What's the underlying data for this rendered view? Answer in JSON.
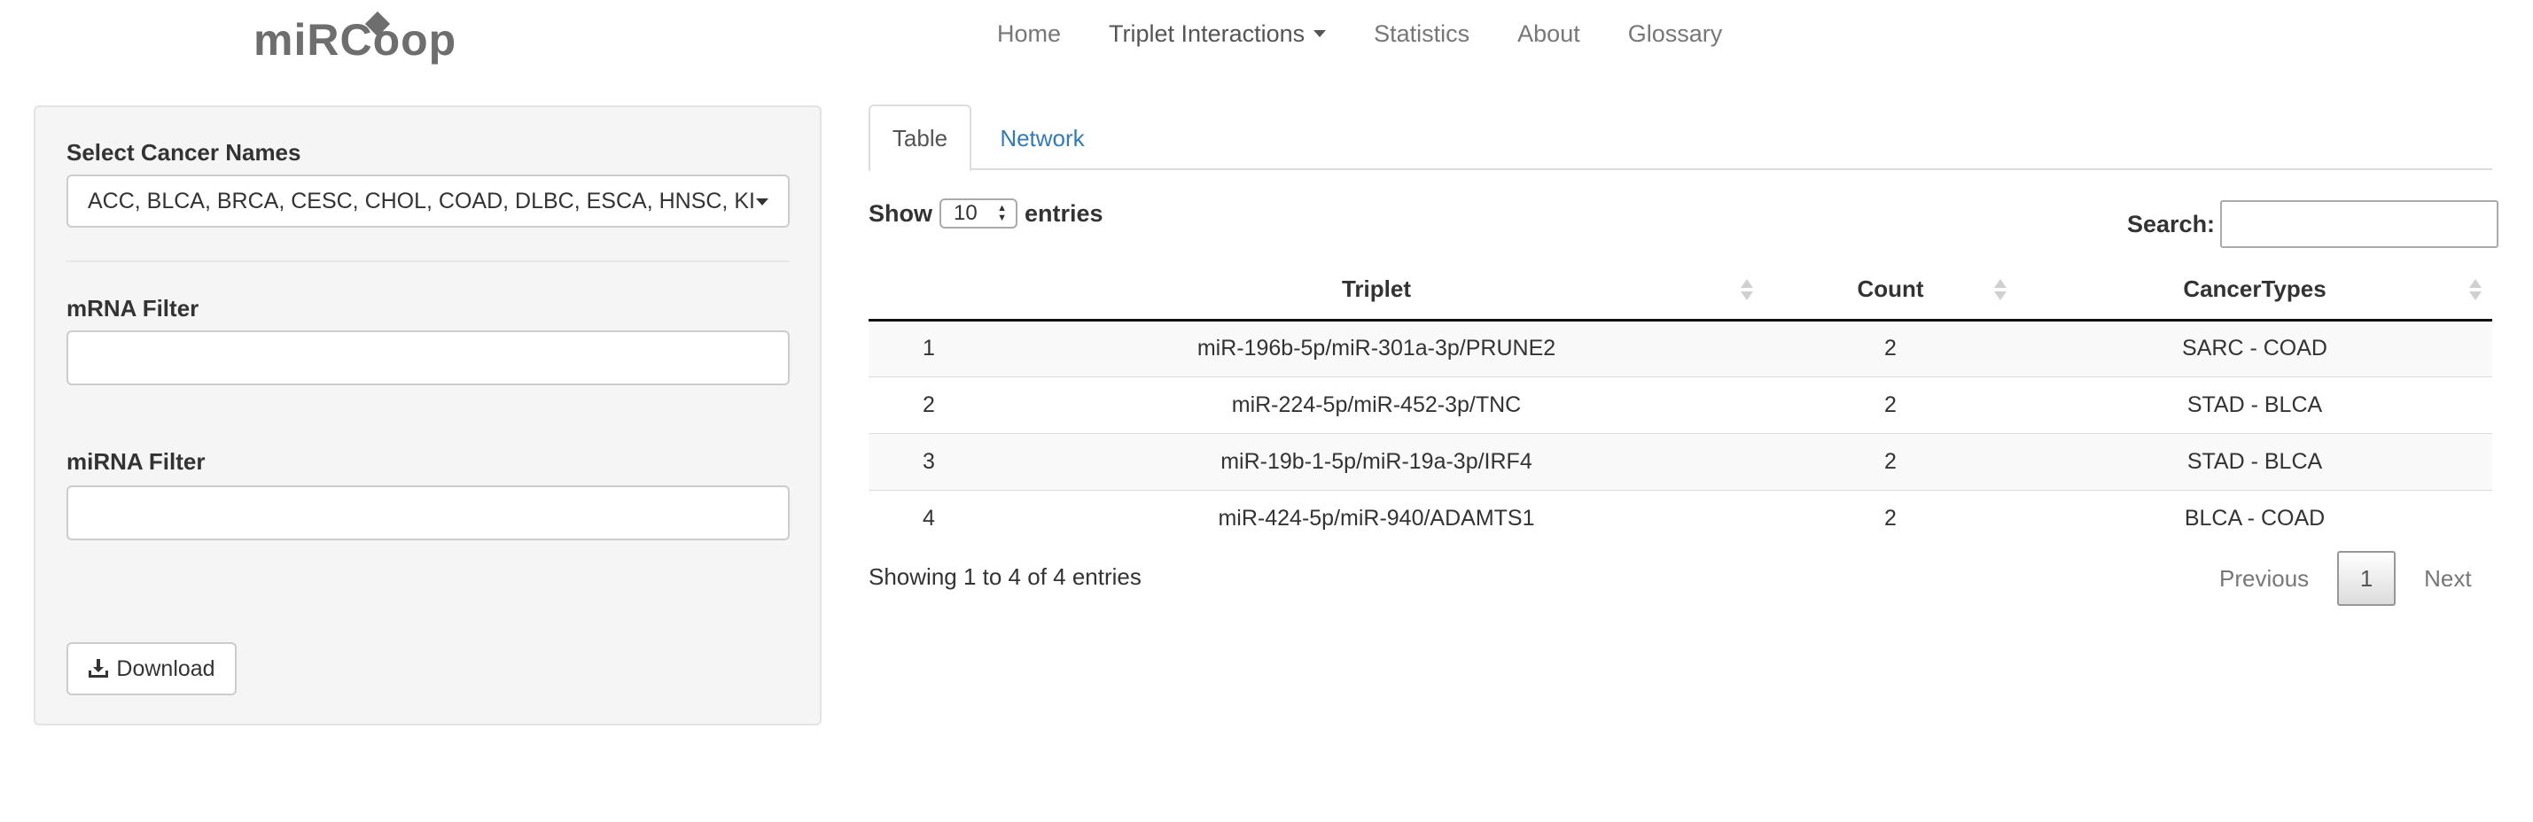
{
  "brand": {
    "logo_text": "miRCoop"
  },
  "nav": {
    "items": [
      {
        "label": "Home"
      },
      {
        "label": "Triplet Interactions"
      },
      {
        "label": "Statistics"
      },
      {
        "label": "About"
      },
      {
        "label": "Glossary"
      }
    ]
  },
  "sidebar": {
    "cancer_label": "Select Cancer Names",
    "cancer_value": "ACC, BLCA, BRCA, CESC, CHOL, COAD, DLBC, ESCA, HNSC, KI",
    "mrna_label": "mRNA Filter",
    "mrna_value": "",
    "mirna_label": "miRNA Filter",
    "mirna_value": "",
    "download_label": "Download"
  },
  "tabs": [
    {
      "label": "Table",
      "active": true
    },
    {
      "label": "Network",
      "active": false
    }
  ],
  "table_controls": {
    "show_label": "Show",
    "length_value": "10",
    "entries_label": "entries",
    "search_label": "Search:",
    "search_value": ""
  },
  "table": {
    "columns": [
      "",
      "Triplet",
      "Count",
      "CancerTypes"
    ],
    "rows": [
      {
        "index": "1",
        "triplet": "miR-196b-5p/miR-301a-3p/PRUNE2",
        "count": "2",
        "cancer_types": "SARC - COAD"
      },
      {
        "index": "2",
        "triplet": "miR-224-5p/miR-452-3p/TNC",
        "count": "2",
        "cancer_types": "STAD - BLCA"
      },
      {
        "index": "3",
        "triplet": "miR-19b-1-5p/miR-19a-3p/IRF4",
        "count": "2",
        "cancer_types": "STAD - BLCA"
      },
      {
        "index": "4",
        "triplet": "miR-424-5p/miR-940/ADAMTS1",
        "count": "2",
        "cancer_types": "BLCA - COAD"
      }
    ]
  },
  "pagination": {
    "info": "Showing 1 to 4 of 4 entries",
    "previous": "Previous",
    "current": "1",
    "next": "Next"
  },
  "colors": {
    "link": "#337ab7",
    "sidebar_bg": "#f5f5f5",
    "logo": "#6e6e6e"
  }
}
